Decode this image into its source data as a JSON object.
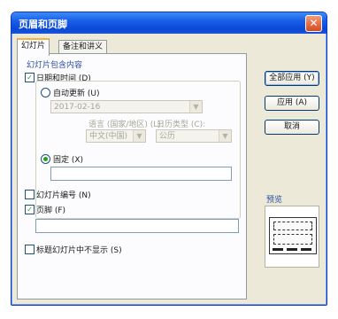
{
  "dialog": {
    "title": "页眉和页脚",
    "close_glyph": "✕"
  },
  "tabs": [
    {
      "label": "幻灯片"
    },
    {
      "label": "备注和讲义"
    }
  ],
  "group": {
    "label": "幻灯片包含内容"
  },
  "date_time": {
    "label": "日期和时间 (D)",
    "checked": true,
    "auto_update_label": "自动更新 (U)",
    "auto_date_value": "2017-02-16",
    "language_label": "语言 (国家/地区) (L):",
    "language_value": "中文(中国)",
    "calendar_label": "日历类型 (C):",
    "calendar_value": "公历",
    "fixed_label": "固定 (X)",
    "fixed_value": ""
  },
  "slide_number": {
    "label": "幻灯片编号 (N)",
    "checked": false
  },
  "footer": {
    "label": "页脚 (F)",
    "checked": true,
    "value": ""
  },
  "hide_on_title": {
    "label": "标题幻灯片中不显示 (S)",
    "checked": false
  },
  "buttons": {
    "apply_all": "全部应用 (Y)",
    "apply": "应用 (A)",
    "cancel": "取消"
  },
  "preview": {
    "label": "预览"
  },
  "icons": {
    "dropdown": "▼",
    "check": "✓"
  }
}
